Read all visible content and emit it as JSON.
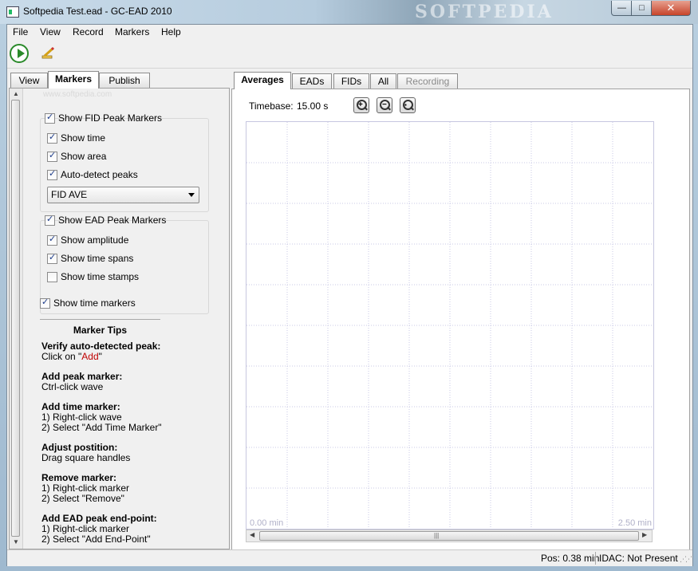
{
  "window": {
    "title": "Softpedia Test.ead - GC-EAD 2010",
    "watermark": "SOFTPEDIA",
    "minimize_glyph": "—",
    "maximize_glyph": "□",
    "close_glyph": "✕"
  },
  "menu": [
    "File",
    "View",
    "Record",
    "Markers",
    "Help"
  ],
  "toolbar": {
    "run_icon": "play-icon",
    "edit_icon": "pencil-icon"
  },
  "left_tabs": [
    "View",
    "Markers",
    "Publish"
  ],
  "left_watermark": "www.softpedia.com",
  "fid_group": {
    "header": "Show FID Peak Markers",
    "header_checked": true,
    "items": [
      {
        "label": "Show time",
        "checked": true
      },
      {
        "label": "Show area",
        "checked": true
      },
      {
        "label": "Auto-detect peaks",
        "checked": true
      }
    ],
    "select_value": "FID AVE"
  },
  "ead_group": {
    "header": "Show EAD Peak Markers",
    "header_checked": true,
    "items": [
      {
        "label": "Show amplitude",
        "checked": true
      },
      {
        "label": "Show time spans",
        "checked": true
      },
      {
        "label": "Show time stamps",
        "checked": false
      }
    ]
  },
  "time_markers": {
    "label": "Show time markers",
    "checked": true
  },
  "tips": {
    "title": "Marker Tips",
    "t1_head": "Verify auto-detected peak:",
    "t1_pre": "Click on \"",
    "t1_link": "Add",
    "t1_post": "\"",
    "t2_head": "Add peak marker:",
    "t2_l1": "Ctrl-click wave",
    "t3_head": "Add time marker:",
    "t3_l1": "1) Right-click wave",
    "t3_l2": "2) Select \"Add Time Marker\"",
    "t4_head": "Adjust postition:",
    "t4_l1": "Drag square handles",
    "t5_head": "Remove marker:",
    "t5_l1": "1) Right-click marker",
    "t5_l2": "2) Select \"Remove\"",
    "t6_head": "Add EAD peak end-point:",
    "t6_l1": "1) Right-click marker",
    "t6_l2": "2) Select \"Add End-Point\""
  },
  "right_tabs": [
    "Averages",
    "EADs",
    "FIDs",
    "All",
    "Recording"
  ],
  "timebase": {
    "label": "Timebase:",
    "value": "15.00 s"
  },
  "plot": {
    "min_label": "0.00 min",
    "max_label": "2.50 min",
    "grid_color": "#c8c8e6"
  },
  "status": {
    "pos": "Pos: 0.38 min",
    "idac": "IDAC: Not Present"
  }
}
